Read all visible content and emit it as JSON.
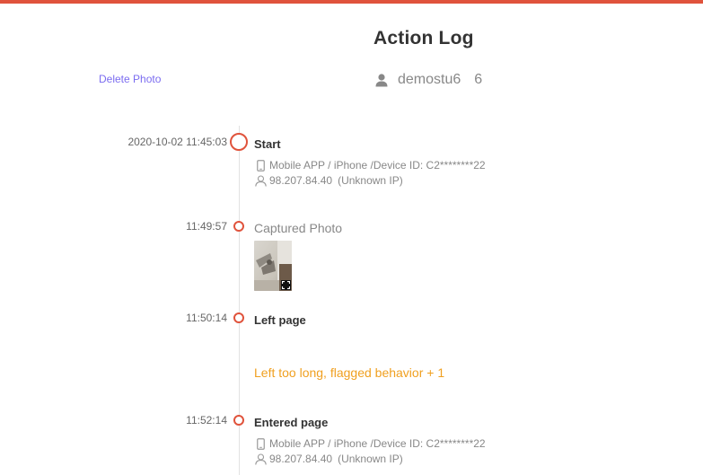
{
  "colors": {
    "accent": "#e0533c",
    "link": "#7b6cf0",
    "warning": "#f0a020",
    "muted": "#888888"
  },
  "header": {
    "title": "Action Log",
    "delete_photo_label": "Delete Photo",
    "username": "demostu6",
    "user_count": "6",
    "user_icon": "user-icon"
  },
  "events": [
    {
      "time": "2020-10-02 11:45:03",
      "title": "Start",
      "device_icon": "phone-icon",
      "device": "Mobile APP / iPhone /Device ID: C2********22",
      "ip_icon": "person-icon",
      "ip": "98.207.84.40",
      "ip_note": "(Unknown IP)"
    },
    {
      "time": "11:49:57",
      "title": "Captured Photo",
      "photo_icon": "expand-icon"
    },
    {
      "time": "11:50:14",
      "title": "Left page",
      "warning": "Left too long, flagged behavior + 1"
    },
    {
      "time": "11:52:14",
      "title": "Entered page",
      "device_icon": "phone-icon",
      "device": "Mobile APP / iPhone /Device ID: C2********22",
      "ip_icon": "person-icon",
      "ip": "98.207.84.40",
      "ip_note": "(Unknown IP)"
    }
  ]
}
